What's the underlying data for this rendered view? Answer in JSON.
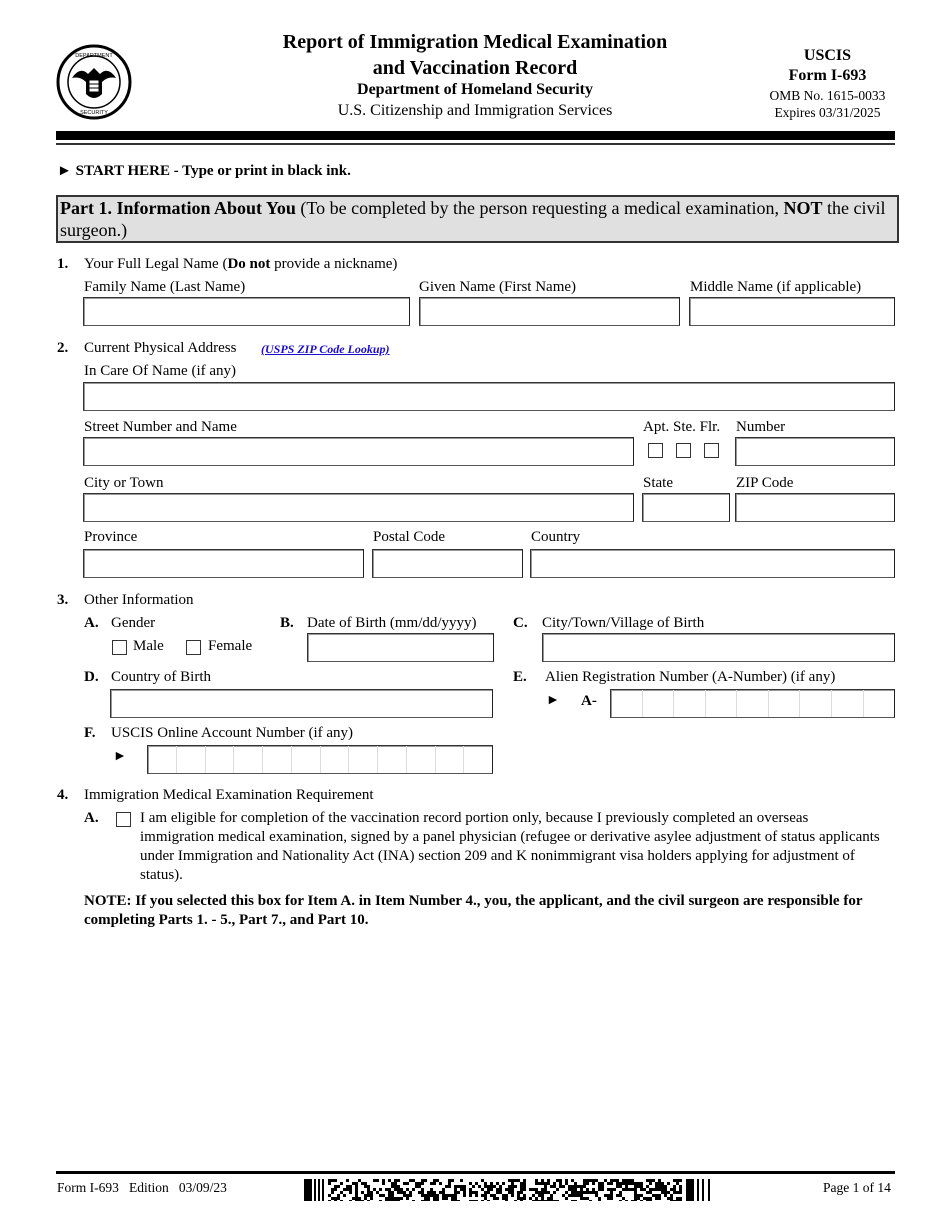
{
  "header": {
    "title_line1": "Report of Immigration Medical Examination",
    "title_line2": "and Vaccination Record",
    "department": "Department of Homeland Security",
    "agency": "U.S. Citizenship and Immigration Services",
    "seal_icon": "dhs-seal-icon",
    "agency_short": "USCIS",
    "form_number": "Form I-693",
    "omb": "OMB No. 1615-0033",
    "expires": "Expires 03/31/2025"
  },
  "start_here": "► START HERE - Type or print in black ink.",
  "part1": {
    "title_bold": "Part 1.  Information About You",
    "title_rest1": " (To be completed by the person requesting a medical examination, ",
    "title_not": "NOT",
    "title_rest2": " the civil surgeon.)"
  },
  "item1": {
    "number": "1.",
    "label_pre": "Your Full Legal Name (",
    "label_bold": "Do not",
    "label_post": " provide a nickname)",
    "family_name_label": "Family Name (Last Name)",
    "given_name_label": "Given Name (First Name)",
    "middle_name_label": "Middle Name (if applicable)",
    "family_name_value": "",
    "given_name_value": "",
    "middle_name_value": ""
  },
  "item2": {
    "number": "2.",
    "label": "Current Physical Address",
    "zip_link": "(USPS ZIP Code Lookup)",
    "care_of_label": "In Care Of Name (if any)",
    "street_label": "Street Number and Name",
    "apt_ste_flr_label": "Apt. Ste. Flr.",
    "number_label": "Number",
    "city_label": "City or Town",
    "state_label": "State",
    "zip_label": "ZIP Code",
    "province_label": "Province",
    "postal_code_label": "Postal Code",
    "country_label": "Country"
  },
  "item3": {
    "number": "3.",
    "label": "Other Information",
    "a_letter": "A.",
    "gender_label": "Gender",
    "male_label": "Male",
    "female_label": "Female",
    "b_letter": "B.",
    "dob_label": "Date of Birth (mm/dd/yyyy)",
    "c_letter": "C.",
    "city_birth_label": "City/Town/Village of Birth",
    "d_letter": "D.",
    "country_birth_label": "Country of Birth",
    "e_letter": "E.",
    "a_number_label": "Alien Registration Number (A-Number) (if any)",
    "a_number_arrow": "►",
    "a_number_prefix": "A-",
    "a_number_cells": 9,
    "f_letter": "F.",
    "online_account_label": "USCIS Online Account Number (if any)",
    "online_account_arrow": "►",
    "online_account_cells": 12
  },
  "item4": {
    "number": "4.",
    "label": "Immigration Medical Examination Requirement",
    "a_letter": "A.",
    "a_text": "I am eligible for completion of the vaccination record portion only, because I previously completed an overseas immigration medical examination, signed by a panel physician (refugee or derivative asylee adjustment of status applicants under Immigration and Nationality Act (INA) section 209 and K nonimmigrant visa holders applying for adjustment of status).",
    "note": "NOTE:  If you selected this box for Item A. in Item Number 4., you, the applicant, and the civil surgeon are responsible for completing Parts 1. - 5., Part 7., and Part 10."
  },
  "footer": {
    "form_edition": "Form I-693   Edition   03/09/23",
    "page": "Page 1 of 14",
    "barcode_icon": "pdf417-barcode-icon"
  }
}
